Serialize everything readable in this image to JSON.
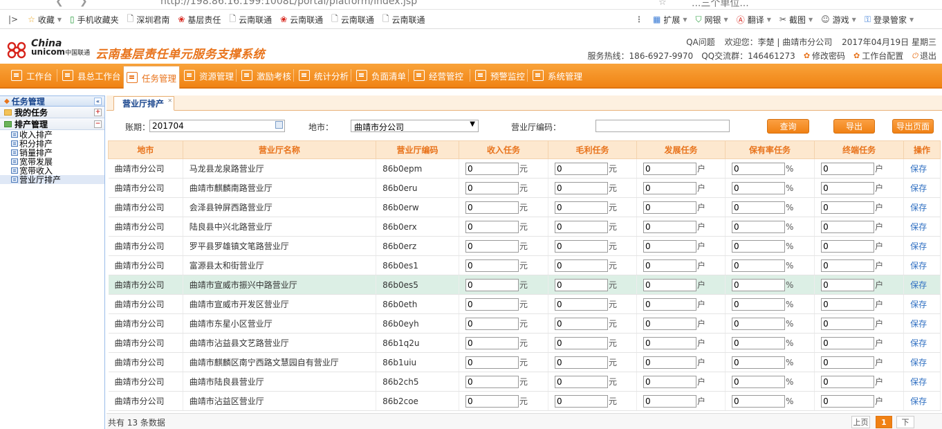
{
  "browser": {
    "url": "http://198.86.16.199:1008L/portal/platform/index.jsp",
    "tab_text": "...三个单位...",
    "bookmarks_left": [
      {
        "label": "收藏",
        "icon": "star-icon",
        "caret": true
      },
      {
        "label": "手机收藏夹",
        "icon": "phone-icon"
      },
      {
        "label": "深圳君南",
        "icon": "page-icon"
      },
      {
        "label": "基层责任",
        "icon": "unicom-icon"
      },
      {
        "label": "云南联通",
        "icon": "page-icon"
      },
      {
        "label": "云南联通",
        "icon": "unicom-icon"
      },
      {
        "label": "云南联通",
        "icon": "page-icon"
      },
      {
        "label": "云南联通",
        "icon": "page-icon"
      }
    ],
    "bookmarks_right": [
      {
        "label": "扩展",
        "icon": "grid-icon"
      },
      {
        "label": "网银",
        "icon": "shield-icon"
      },
      {
        "label": "翻译",
        "icon": "translate-icon"
      },
      {
        "label": "截图",
        "icon": "scissors-icon"
      },
      {
        "label": "游戏",
        "icon": "gamepad-icon"
      },
      {
        "label": "登录管家",
        "icon": "key-icon"
      }
    ]
  },
  "header": {
    "logo_line1": "China",
    "logo_line2": "unicom",
    "logo_cn": "中国联通",
    "system_title": "云南基层责任单元服务支撑系统",
    "qa": "QA问题",
    "welcome": "欢迎您：李楚 | 曲靖市分公司",
    "date": "2017年04月19日 星期三",
    "hotline": "服务热线：186-6927-9970",
    "qq": "QQ交流群：146461273",
    "change_password": "修改密码",
    "workbench_config": "工作台配置",
    "logout": "退出"
  },
  "menu": [
    {
      "label": "工作台"
    },
    {
      "label": "县总工作台"
    },
    {
      "label": "任务管理",
      "active": true
    },
    {
      "label": "资源管理"
    },
    {
      "label": "激励考核"
    },
    {
      "label": "统计分析"
    },
    {
      "label": "负面清单"
    },
    {
      "label": "经营管控"
    },
    {
      "label": "预警监控"
    },
    {
      "label": "系统管理"
    }
  ],
  "sidebar": {
    "title": "任务管理",
    "groups": [
      {
        "label": "我的任务",
        "toggle": "+"
      },
      {
        "label": "排产管理",
        "toggle": "−"
      }
    ],
    "items": [
      "收入排产",
      "积分排产",
      "销量排产",
      "宽带发展",
      "宽带收入",
      "营业厅排产"
    ],
    "selected": "营业厅排产"
  },
  "tab": {
    "label": "营业厅排产"
  },
  "filter": {
    "period_label": "账期：",
    "period_value": "201704",
    "city_label": "地市：",
    "city_value": "曲靖市分公司",
    "hall_code_label": "营业厅编码：",
    "hall_code_value": "",
    "query_button": "查询",
    "export_button": "导出",
    "export_page_button": "导出页面"
  },
  "table": {
    "columns": [
      "地市",
      "营业厅名称",
      "营业厅编码",
      "收入任务",
      "毛利任务",
      "发展任务",
      "保有率任务",
      "终端任务",
      "操作"
    ],
    "units": [
      "元",
      "元",
      "户",
      "%",
      "户"
    ],
    "action_label": "保存",
    "rows": [
      {
        "city": "曲靖市分公司",
        "name": "马龙县龙泉路营业厅",
        "code": "86b0epm",
        "values": [
          "0",
          "0",
          "0",
          "0",
          "0"
        ]
      },
      {
        "city": "曲靖市分公司",
        "name": "曲靖市麒麟南路营业厅",
        "code": "86b0eru",
        "values": [
          "0",
          "0",
          "0",
          "0",
          "0"
        ]
      },
      {
        "city": "曲靖市分公司",
        "name": "会泽县钟屏西路营业厅",
        "code": "86b0erw",
        "values": [
          "0",
          "0",
          "0",
          "0",
          "0"
        ]
      },
      {
        "city": "曲靖市分公司",
        "name": "陆良县中兴北路营业厅",
        "code": "86b0erx",
        "values": [
          "0",
          "0",
          "0",
          "0",
          "0"
        ]
      },
      {
        "city": "曲靖市分公司",
        "name": "罗平县罗雄镇文笔路营业厅",
        "code": "86b0erz",
        "values": [
          "0",
          "0",
          "0",
          "0",
          "0"
        ]
      },
      {
        "city": "曲靖市分公司",
        "name": "富源县太和街营业厅",
        "code": "86b0es1",
        "values": [
          "0",
          "0",
          "0",
          "0",
          "0"
        ]
      },
      {
        "city": "曲靖市分公司",
        "name": "曲靖市宣威市振兴中路营业厅",
        "code": "86b0es5",
        "values": [
          "0",
          "0",
          "0",
          "0",
          "0"
        ],
        "highlight": true
      },
      {
        "city": "曲靖市分公司",
        "name": "曲靖市宣威市开发区营业厅",
        "code": "86b0eth",
        "values": [
          "0",
          "0",
          "0",
          "0",
          "0"
        ]
      },
      {
        "city": "曲靖市分公司",
        "name": "曲靖市东星小区营业厅",
        "code": "86b0eyh",
        "values": [
          "0",
          "0",
          "0",
          "0",
          "0"
        ]
      },
      {
        "city": "曲靖市分公司",
        "name": "曲靖市沾益县文艺路营业厅",
        "code": "86b1q2u",
        "values": [
          "0",
          "0",
          "0",
          "0",
          "0"
        ]
      },
      {
        "city": "曲靖市分公司",
        "name": "曲靖市麒麟区南宁西路文慧园自有营业厅",
        "code": "86b1uiu",
        "values": [
          "0",
          "0",
          "0",
          "0",
          "0"
        ]
      },
      {
        "city": "曲靖市分公司",
        "name": "曲靖市陆良县营业厅",
        "code": "86b2ch5",
        "values": [
          "0",
          "0",
          "0",
          "0",
          "0"
        ]
      },
      {
        "city": "曲靖市分公司",
        "name": "曲靖市沾益区营业厅",
        "code": "86b2coe",
        "values": [
          "0",
          "0",
          "0",
          "0",
          "0"
        ]
      }
    ]
  },
  "footer": {
    "total": "共有 13 条数据",
    "prev": "上页",
    "current_page": "1",
    "next": "下"
  }
}
